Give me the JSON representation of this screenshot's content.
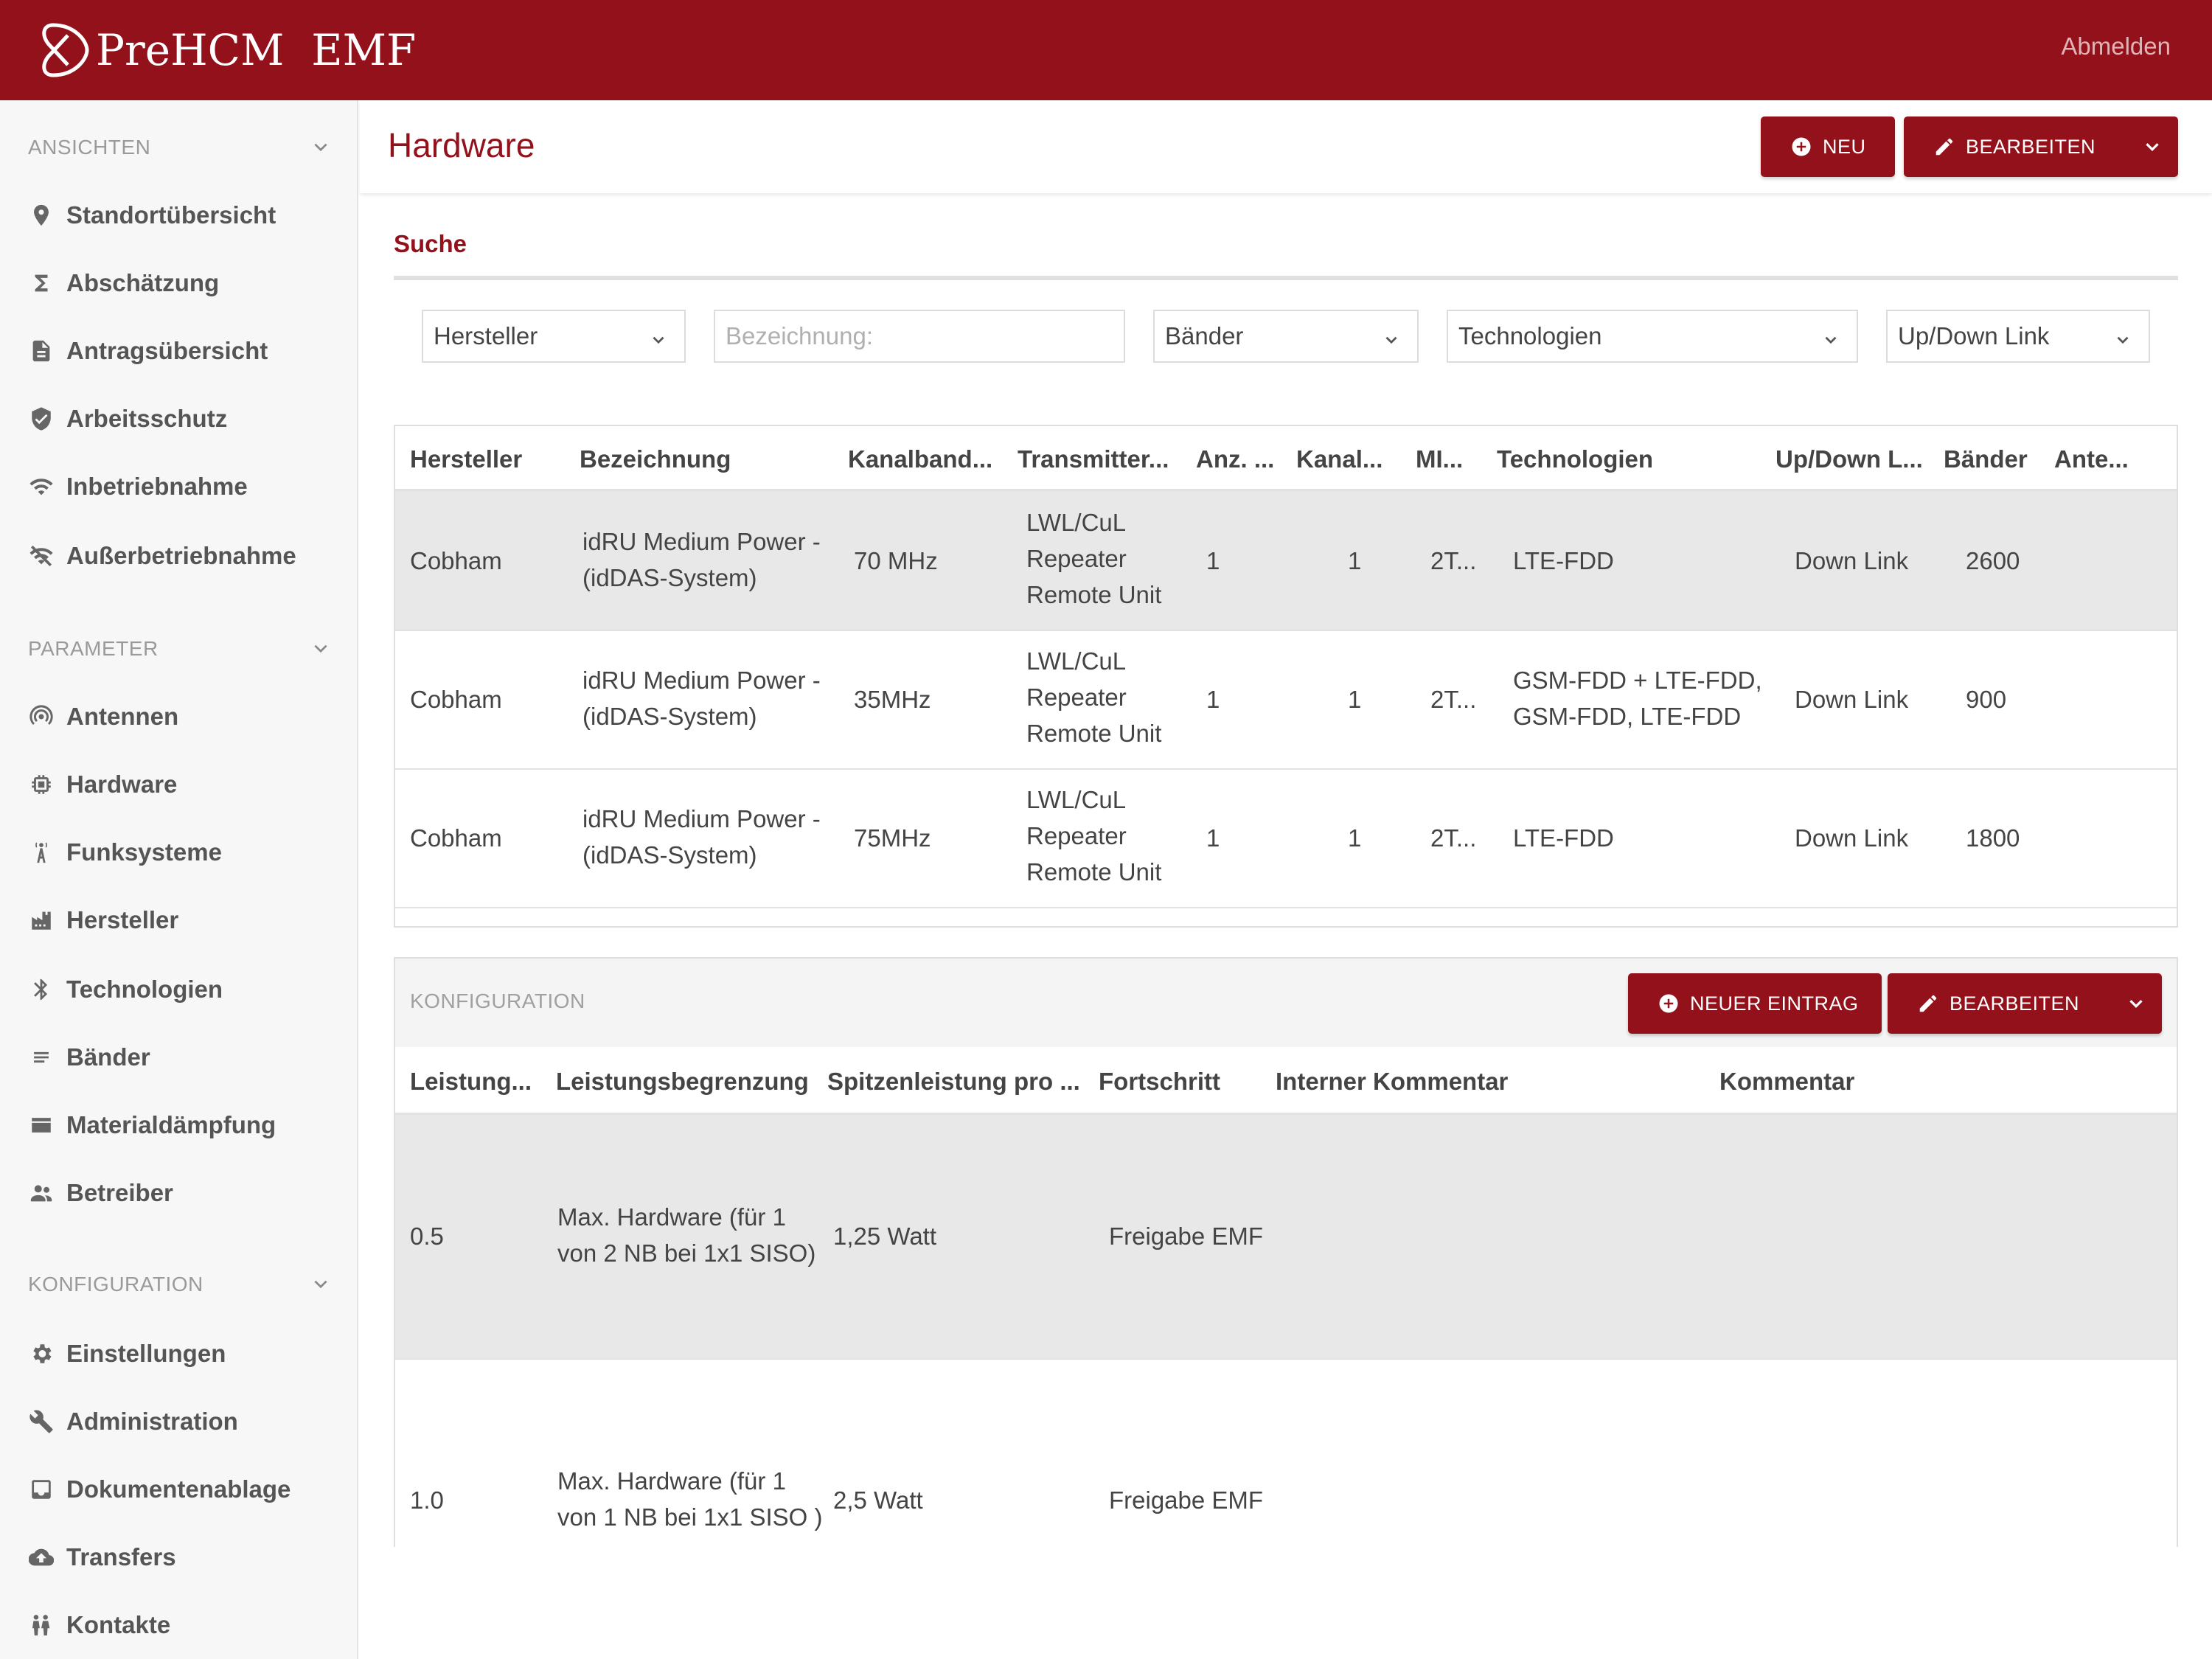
{
  "app": {
    "brand": "PreHCM  EMF",
    "logout_label": "Abmelden"
  },
  "sidebar": {
    "sections": [
      {
        "title": "ANSICHTEN",
        "items": [
          {
            "label": "Standortübersicht",
            "icon": "map-pin-icon"
          },
          {
            "label": "Abschätzung",
            "icon": "sigma-icon"
          },
          {
            "label": "Antragsübersicht",
            "icon": "document-icon"
          },
          {
            "label": "Arbeitsschutz",
            "icon": "shield-check-icon"
          },
          {
            "label": "Inbetriebnahme",
            "icon": "wifi-icon"
          },
          {
            "label": "Außerbetriebnahme",
            "icon": "wifi-off-icon"
          }
        ]
      },
      {
        "title": "PARAMETER",
        "items": [
          {
            "label": "Antennen",
            "icon": "antenna-icon"
          },
          {
            "label": "Hardware",
            "icon": "chip-icon"
          },
          {
            "label": "Funksysteme",
            "icon": "radio-tower-icon"
          },
          {
            "label": "Hersteller",
            "icon": "factory-icon"
          },
          {
            "label": "Technologien",
            "icon": "bluetooth-icon"
          },
          {
            "label": "Bänder",
            "icon": "lines-icon"
          },
          {
            "label": "Materialdämpfung",
            "icon": "layer-icon"
          },
          {
            "label": "Betreiber",
            "icon": "people-icon"
          }
        ]
      },
      {
        "title": "KONFIGURATION",
        "items": [
          {
            "label": "Einstellungen",
            "icon": "gear-icon"
          },
          {
            "label": "Administration",
            "icon": "wrench-icon"
          },
          {
            "label": "Dokumentenablage",
            "icon": "inbox-icon"
          },
          {
            "label": "Transfers",
            "icon": "cloud-upload-icon"
          },
          {
            "label": "Kontakte",
            "icon": "contacts-icon"
          }
        ]
      }
    ]
  },
  "header": {
    "title": "Hardware",
    "new_label": "NEU",
    "edit_label": "BEARBEITEN"
  },
  "search": {
    "label": "Suche",
    "hersteller": "Hersteller",
    "bezeichnung_placeholder": "Bezeichnung:",
    "baender": "Bänder",
    "technologien": "Technologien",
    "updown": "Up/Down Link"
  },
  "hardware_table": {
    "columns": [
      "Hersteller",
      "Bezeichnung",
      "Kanalband...",
      "Transmitter...",
      "Anz. ...",
      "Kanal...",
      "MI...",
      "Technologien",
      "Up/Down L...",
      "Bänder",
      "Ante..."
    ],
    "rows": [
      {
        "hersteller": "Cobham",
        "bezeichnung": "idRU Medium Power - (idDAS-System)",
        "kanalband": "70 MHz",
        "transmitter": "LWL/CuL Repeater Remote Unit",
        "anz": "1",
        "kanal": "1",
        "mi": "2T...",
        "technologien": "LTE-FDD",
        "updown": "Down Link",
        "baender": "2600",
        "ante": ""
      },
      {
        "hersteller": "Cobham",
        "bezeichnung": "idRU Medium Power - (idDAS-System)",
        "kanalband": "35MHz",
        "transmitter": "LWL/CuL Repeater Remote Unit",
        "anz": "1",
        "kanal": "1",
        "mi": "2T...",
        "technologien": "GSM-FDD + LTE-FDD, GSM-FDD, LTE-FDD",
        "updown": "Down Link",
        "baender": "900",
        "ante": ""
      },
      {
        "hersteller": "Cobham",
        "bezeichnung": "idRU Medium Power - (idDAS-System)",
        "kanalband": "75MHz",
        "transmitter": "LWL/CuL Repeater Remote Unit",
        "anz": "1",
        "kanal": "1",
        "mi": "2T...",
        "technologien": "LTE-FDD",
        "updown": "Down Link",
        "baender": "1800",
        "ante": ""
      }
    ]
  },
  "config": {
    "title": "KONFIGURATION",
    "new_entry_label": "NEUER EINTRAG",
    "edit_label": "BEARBEITEN",
    "columns": [
      "Leistung...",
      "Leistungsbegrenzung",
      "Spitzenleistung pro ...",
      "Fortschritt",
      "Interner Kommentar",
      "Kommentar"
    ],
    "rows": [
      {
        "leistung": "0.5",
        "begrenzung": "Max. Hardware (für 1 von 2 NB bei 1x1 SISO)",
        "spitze": "1,25 Watt",
        "fortschritt": "Freigabe EMF",
        "intern": "",
        "kommentar": ""
      },
      {
        "leistung": "1.0",
        "begrenzung": "Max. Hardware (für 1 von 1 NB bei 1x1 SISO )",
        "spitze": "2,5 Watt",
        "fortschritt": "Freigabe EMF",
        "intern": "",
        "kommentar": ""
      }
    ]
  },
  "colors": {
    "brand": "#93111b",
    "sidebar_bg": "#f7f7f7",
    "row_highlight": "#e8e8e8"
  }
}
